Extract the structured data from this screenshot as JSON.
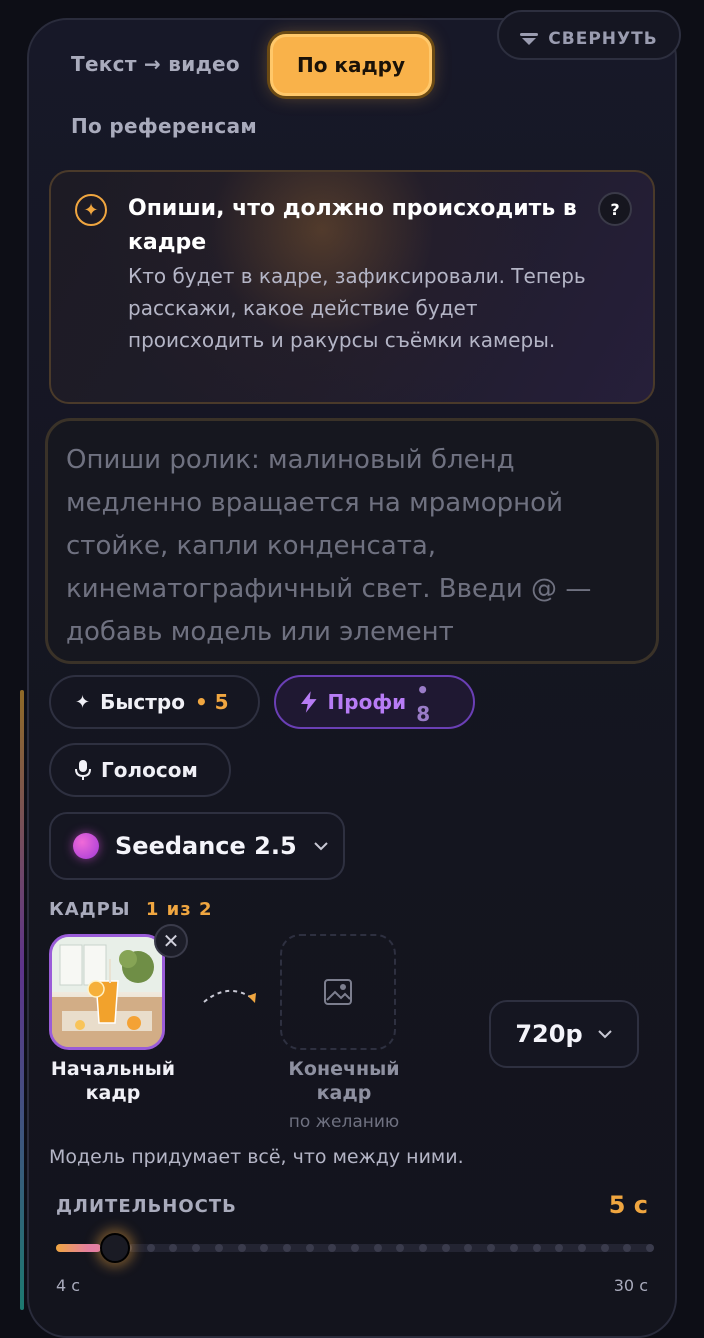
{
  "header": {
    "collapse_label": "СВЕРНУТЬ"
  },
  "tabs": [
    {
      "label": "Текст → видео",
      "active": false
    },
    {
      "label": "По кадру",
      "active": true
    },
    {
      "label": "По референсам",
      "active": false
    }
  ],
  "hint": {
    "title": "Опиши, что должно происходить в кадре",
    "body": "Кто будет в кадре, зафиксировали. Теперь расскажи, какое действие будет происходить и ракурсы съёмки камеры.",
    "help_label": "?"
  },
  "prompt": {
    "value": "",
    "placeholder": "Опиши ролик: малиновый бленд медленно вращается на мраморной стойке, капли конденсата, кинематографичный свет. Введи @ — добавь модель или элемент"
  },
  "modes": {
    "fast": {
      "label": "Быстро",
      "cost": "• 5"
    },
    "pro": {
      "label": "Профи",
      "cost": "• 8"
    },
    "voice": {
      "label": "Голосом"
    }
  },
  "model": {
    "name": "Seedance 2.5"
  },
  "frames": {
    "label": "КАДРЫ",
    "count": "1 из 2",
    "start_label": "Начальный кадр",
    "end_label": "Конечный кадр",
    "end_sub": "по желанию",
    "between_note": "Модель придумает всё, что между ними."
  },
  "resolution": {
    "value": "720p"
  },
  "duration": {
    "label": "ДЛИТЕЛЬНОСТЬ",
    "value_label": "5 с",
    "min": 4,
    "max": 30,
    "value": 5,
    "min_label": "4 с",
    "max_label": "30 с"
  },
  "colors": {
    "accent": "#f9b24a",
    "pro": "#b77cf5",
    "panel": "#171828"
  }
}
